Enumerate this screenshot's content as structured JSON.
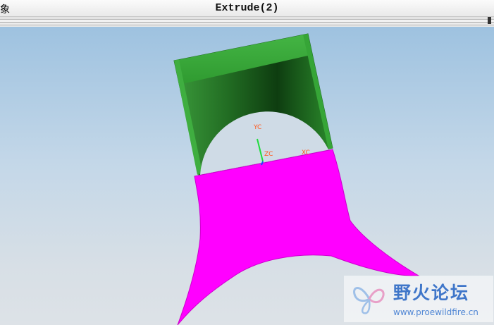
{
  "window": {
    "left_fragment": "象",
    "title": "Extrude(2)"
  },
  "viewport": {
    "background_top": "#9ec2e0",
    "background_bottom": "#dde2e7",
    "axis_labels": {
      "yc": "YC",
      "zc": "ZC",
      "xc": "XC"
    },
    "model": {
      "extrude_color": "#39a83a",
      "sheet_color": "#ff00ff"
    }
  },
  "watermark": {
    "name": "野火论坛",
    "url": "www.proewildfire.cn"
  }
}
